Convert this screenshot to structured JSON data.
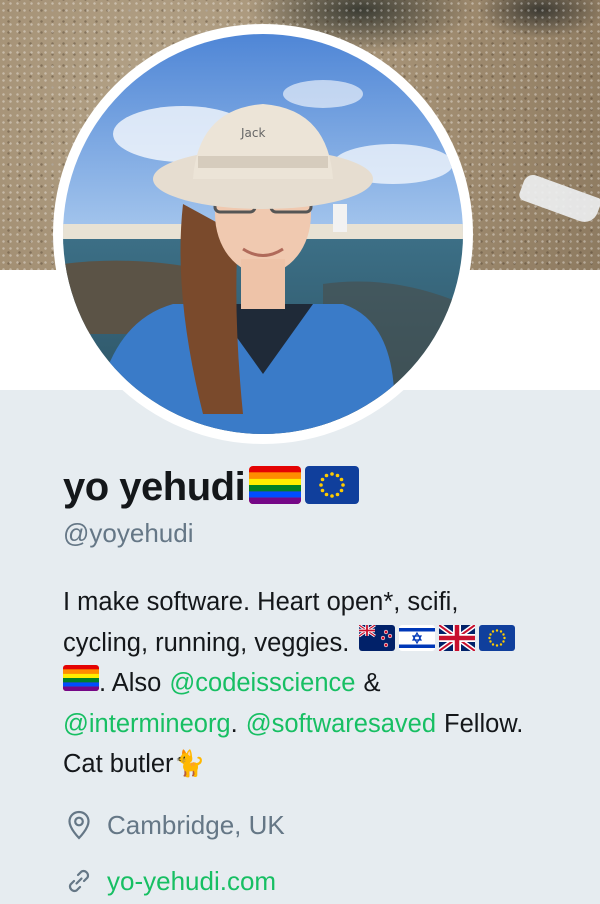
{
  "profile": {
    "display_name": "yo yehudi",
    "handle": "@yoyehudi",
    "bio": {
      "line1": "I make software. Heart open*, scifi,",
      "line2_text": "cycling, running, veggies.",
      "line3_text": ". Also",
      "line3_mention": "@codeisscience",
      "line3_amp": "&",
      "line4_mention1": "@intermineorg",
      "line4_sep": ".",
      "line4_mention2": "@softwaresaved",
      "line4_text": "Fellow.",
      "line5_text": "Cat butler",
      "line5_emoji": "🐈"
    },
    "location": "Cambridge, UK",
    "website": "yo-yehudi.com"
  },
  "flags": {
    "name_flags": [
      "rainbow-flag",
      "eu-flag"
    ],
    "bio_flags": [
      "new-zealand-flag",
      "israel-flag",
      "uk-flag",
      "eu-flag",
      "rainbow-flag"
    ]
  },
  "colors": {
    "accent_green": "#17bf63",
    "muted_text": "#657786",
    "primary_text": "#14171a",
    "page_bg": "#e6ecf0"
  },
  "icons": {
    "location": "map-pin-icon",
    "website": "link-icon"
  }
}
